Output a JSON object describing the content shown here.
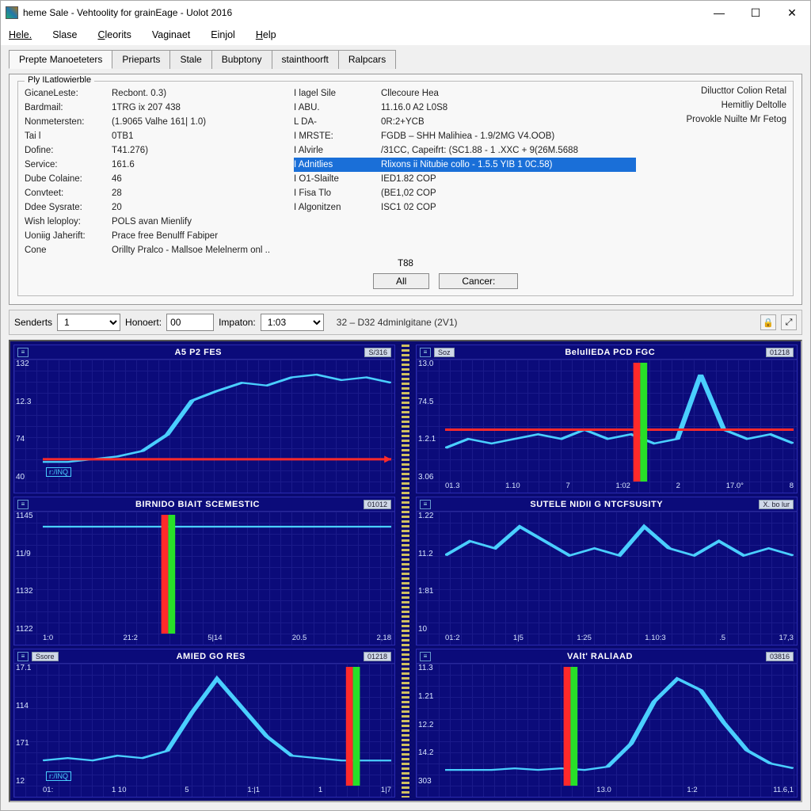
{
  "title": "heme Sale - Vehtoolity for grainEage - Uolot 2016",
  "menu": [
    "Hele.",
    "Slase",
    "Cleorits",
    "Vaginaet",
    "Einjol",
    "Help"
  ],
  "tabs": [
    "Prepte Manoeteters",
    "Prieparts",
    "Stale",
    "Bubptony",
    "stainthoorft",
    "Ralpcars"
  ],
  "active_tab": 0,
  "group_title": "Ply ILatlowierble",
  "left_kv": [
    {
      "k": "GicaneLeste:",
      "v": "Recbont. 0.3)"
    },
    {
      "k": "Bardmail:",
      "v": "1TRG ix 207 438"
    },
    {
      "k": "Nonmetersten:",
      "v": "(1.9065 Valhe 161| 1.0)"
    },
    {
      "k": "Tai l",
      "v": "0TB1"
    },
    {
      "k": "Dofine:",
      "v": "T41.276)"
    },
    {
      "k": "Service:",
      "v": "161.6"
    },
    {
      "k": "Dube Colaine:",
      "v": "46"
    },
    {
      "k": "Convteet:",
      "v": "28"
    },
    {
      "k": "Ddee Sysrate:",
      "v": "20"
    },
    {
      "k": "Wish leloploy:",
      "v": "POLS avan Mienlify"
    },
    {
      "k": "Uoniig Jaherift:",
      "v": "Prace free Benulff Fabiper"
    },
    {
      "k": "Cone",
      "v": "Orillty Pralco - Mallsoe Melelnerm onl   .."
    }
  ],
  "mid_kv": [
    {
      "k": "I  lagel Sile",
      "v": "Cllecoure Hea"
    },
    {
      "k": "I  ABU.",
      "v": "11.16.0 A2 L0S8"
    },
    {
      "k": "L  DA-",
      "v": "0R:2+YCB"
    },
    {
      "k": "I  MRSTE:",
      "v": "FGDB – SHH Malihiea - 1.9/2MG V4.OOB)"
    },
    {
      "k": "I  Alvirle",
      "v": "/31CC, Capeifrt: (SC1.88 - 1 .XXC + 9(26M.5688"
    },
    {
      "k": "I  Adnitlies",
      "v": "Rlixons ii Nitubie collo - 1.5.5 YIB 1 0C.58)",
      "sel": true
    },
    {
      "k": "I  O1-Slailte",
      "v": "IED1.82 COP"
    },
    {
      "k": "I  Fisa Tlo",
      "v": "(BE1,02 COP"
    },
    {
      "k": "I  Algonitzen",
      "v": "ISC1 02 COP"
    }
  ],
  "mid_footer_val": "T88",
  "right_links": [
    "Dilucttor Colion Retal",
    "Hemitliy Deltolle",
    "Provokle Nuilte Mr Fetog"
  ],
  "buttons": {
    "all": "All",
    "cancel": "Cancer:"
  },
  "ctrlbar": {
    "senders_label": "Senderts",
    "senders_value": "1",
    "honoert_label": "Honoert:",
    "honoert_value": "00",
    "imp_label": "Impaton:",
    "imp_value": "1:03",
    "status": "32 – D32  4dminlgitane (2V1)"
  },
  "chart_data": [
    {
      "id": "c1",
      "title": "A5 P2 FES",
      "badge": "S/316",
      "tag": "r:/INQ",
      "ylabels": [
        "132",
        "12.3",
        "74",
        "40"
      ],
      "xlabels": [],
      "type": "line",
      "series": [
        {
          "name": "main",
          "values": [
            10,
            10,
            12,
            14,
            18,
            30,
            55,
            62,
            68,
            66,
            72,
            74,
            70,
            72,
            68
          ]
        }
      ],
      "markers": {
        "hline": 12,
        "red_arrow": true
      }
    },
    {
      "id": "c2",
      "title": "BelulIEDA PCD FGC",
      "badge": "01218",
      "head_ico": "Soz",
      "ylabels": [
        "13.0",
        "74.5",
        "1.2.1",
        "3.06"
      ],
      "xlabels": [
        "01.3",
        "1.10",
        "7",
        "1:02",
        "2",
        "17.0°",
        "8"
      ],
      "type": "line",
      "series": [
        {
          "name": "main",
          "values": [
            6,
            8,
            7,
            8,
            9,
            8,
            10,
            8,
            9,
            7,
            8,
            22,
            10,
            8,
            9,
            7
          ]
        }
      ],
      "markers": {
        "hline": 10,
        "vline_red": 0.55,
        "vline_green": 0.57
      }
    },
    {
      "id": "c3",
      "title": "BIRNIDO BIAIT SCEMESTIC",
      "badge": "01012",
      "ylabels": [
        "1145",
        "11/9",
        "1132",
        "1122"
      ],
      "xlabels": [
        "1:0",
        "21:2",
        "5|14",
        "20.5",
        "2,18"
      ],
      "type": "line",
      "series": [
        {
          "name": "main",
          "values": [
            5,
            5,
            5,
            5,
            5,
            5,
            5,
            5,
            5,
            5,
            5,
            5,
            5
          ]
        }
      ],
      "markers": {
        "vline_red": 0.35,
        "vline_green": 0.37
      }
    },
    {
      "id": "c4",
      "title": "SUTELE NIDII G NTCFSUSITY",
      "badge": "X. bo lur",
      "ylabels": [
        "1.22",
        "11.2",
        "1:81",
        "10"
      ],
      "xlabels": [
        "01:2",
        "1|5",
        "1:25",
        "1.10:3",
        ".5",
        "17,3"
      ],
      "type": "line",
      "series": [
        {
          "name": "main",
          "values": [
            10,
            12,
            11,
            14,
            12,
            10,
            11,
            10,
            14,
            11,
            10,
            12,
            10,
            11,
            10
          ]
        }
      ],
      "markers": {}
    },
    {
      "id": "c5",
      "title": "AMIED GO RES",
      "badge": "01218",
      "tag": "r:/INQ",
      "head_ico": "Ssore",
      "ylabels": [
        "17.1",
        "114",
        "171",
        "12"
      ],
      "xlabels": [
        "01:",
        "1 10",
        "5",
        "1:|1",
        "1",
        "1|7"
      ],
      "type": "line",
      "series": [
        {
          "name": "main",
          "values": [
            8,
            9,
            8,
            10,
            9,
            12,
            28,
            42,
            30,
            18,
            10,
            9,
            8,
            8,
            8
          ]
        }
      ],
      "markers": {
        "vline_red": 0.88,
        "vline_green": 0.9
      }
    },
    {
      "id": "c6",
      "title": "VAlt' RALlAAD",
      "badge": "03816",
      "ylabels": [
        "11.3",
        "1.21",
        "12.2",
        "14.2",
        "303"
      ],
      "xlabels": [
        "",
        "",
        "13.0",
        "1:2",
        "11.6,1"
      ],
      "type": "line",
      "series": [
        {
          "name": "main",
          "values": [
            6,
            6,
            6,
            7,
            6,
            7,
            6,
            8,
            22,
            48,
            62,
            55,
            35,
            18,
            10,
            7
          ]
        }
      ],
      "markers": {
        "vline_red": 0.35,
        "vline_green": 0.37
      }
    }
  ]
}
